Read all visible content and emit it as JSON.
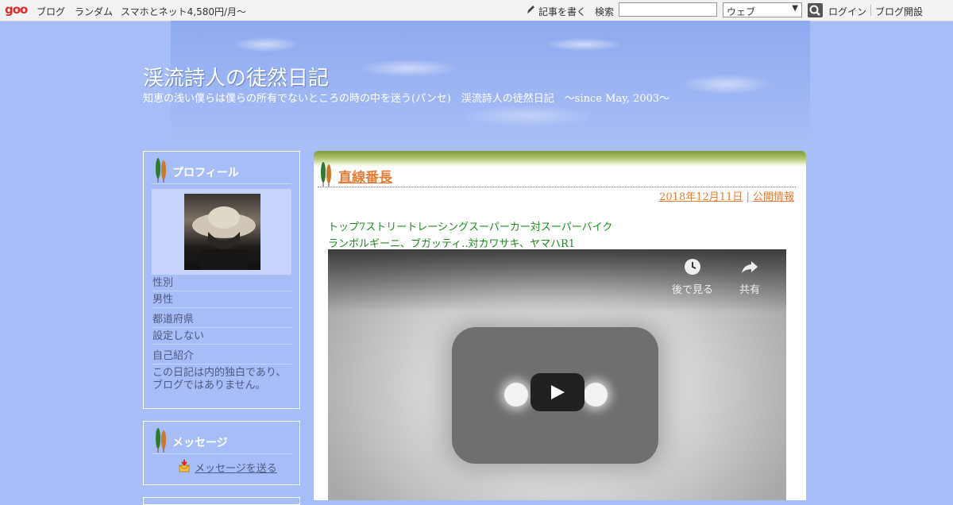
{
  "topbar": {
    "logo": "goo",
    "links": [
      "ブログ",
      "ランダム",
      "スマホとネット4,580円/月～"
    ],
    "write": "記事を書く",
    "search_label": "検索",
    "search_value": "",
    "select_value": "ウェブ",
    "login": "ログイン",
    "open_blog": "ブログ開設"
  },
  "header": {
    "title": "渓流詩人の徒然日記",
    "description": "知恵の浅い僕らは僕らの所有でないところの時の中を迷う(パンセ)　渓流詩人の徒然日記　～since May, 2003～"
  },
  "profile": {
    "title": "プロフィール",
    "rows": [
      {
        "label": "性別",
        "value": "男性"
      },
      {
        "label": "都道府県",
        "value": "設定しない"
      },
      {
        "label": "自己紹介",
        "value_lines": [
          "この日記は内的独白であり、",
          "ブログではありません。"
        ]
      }
    ]
  },
  "message": {
    "title": "メッセージ",
    "link": "メッセージを送る"
  },
  "post": {
    "title": "直線番長",
    "date": "2018年12月11日",
    "separator": "|",
    "visibility": "公開情報",
    "lines": [
      "トップ7ストリートレーシングスーパーカー対スーパーバイク",
      "ランボルギーニ、ブガッティ..対カワサキ、ヤマハR1"
    ],
    "video": {
      "watch_later": "後で見る",
      "share": "共有"
    }
  },
  "colors": {
    "background": "#a7bdf7",
    "title_link": "#e27d3a",
    "body_text": "#1d8b1d"
  }
}
